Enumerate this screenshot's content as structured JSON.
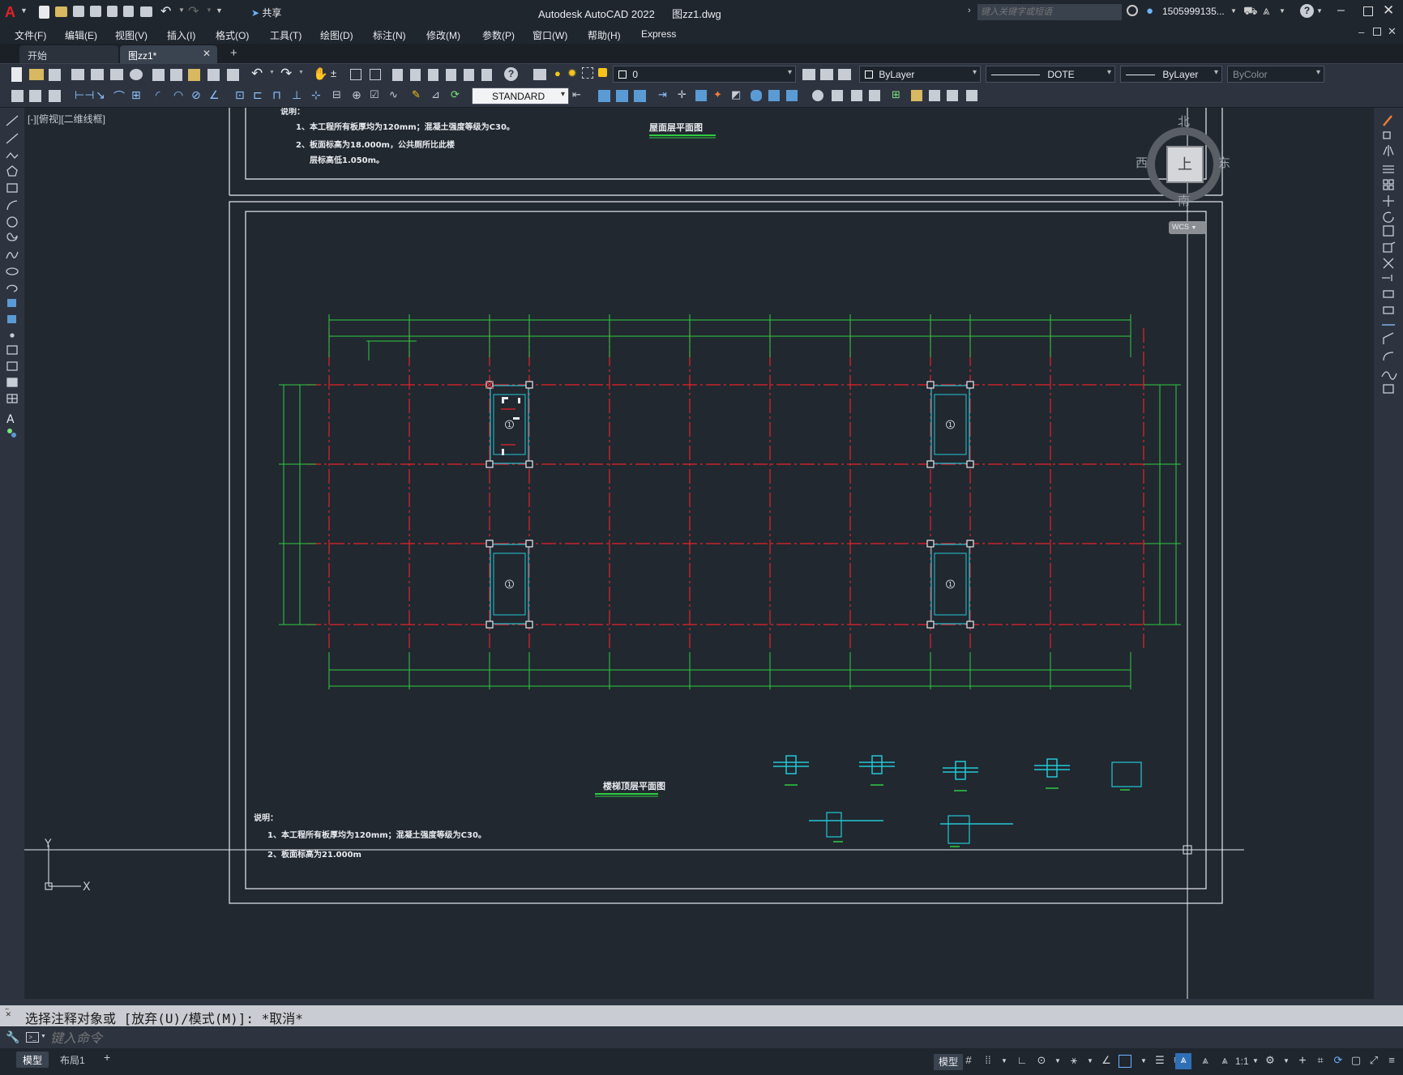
{
  "titlebar": {
    "app_title": "Autodesk AutoCAD 2022",
    "file_name": "图zz1.dwg",
    "share_label": "共享",
    "search_placeholder": "键入关键字或短语",
    "user_name": "1505999135...",
    "help_icon": "help-icon"
  },
  "menus": [
    "文件(F)",
    "编辑(E)",
    "视图(V)",
    "插入(I)",
    "格式(O)",
    "工具(T)",
    "绘图(D)",
    "标注(N)",
    "修改(M)",
    "参数(P)",
    "窗口(W)",
    "帮助(H)",
    "Express"
  ],
  "tabs": {
    "start": "开始",
    "active": "图zz1*",
    "add": "+"
  },
  "layer_combo": "0",
  "color_combo": "ByLayer",
  "linetype_combo": "DOTE",
  "lineweight_combo": "ByLayer",
  "plotstyle_combo": "ByColor",
  "textstyle_combo": "STANDARD",
  "viewport_label": "[-][俯视][二维线框]",
  "viewcube": {
    "north": "北",
    "south": "南",
    "east": "东",
    "west": "西",
    "top": "上",
    "wcs": "WCS"
  },
  "drawing": {
    "top_notes_title": "说明：",
    "top_note_1": "1、本工程所有板厚均为120mm；混凝土强度等级为C30。",
    "top_note_2": "2、板面标高为18.000m，公共厕所比此楼",
    "top_note_3": "层标高低1.050m。",
    "top_plan_title": "屋面层平面图",
    "bottom_plan_title": "楼梯顶层平面图",
    "bottom_notes_title": "说明：",
    "bottom_note_1": "1、本工程所有板厚均为120mm；混凝土强度等级为C30。",
    "bottom_note_2": "2、板面标高为21.000m",
    "slab_mark": "1",
    "ucs_y": "Y",
    "ucs_x": "X"
  },
  "command": {
    "history": "选择注释对象或 [放弃(U)/模式(M)]: *取消*",
    "placeholder": "键入命令"
  },
  "status": {
    "model_tab": "模型",
    "layout_tab": "布局1",
    "add_tab": "+",
    "scale": "1:1"
  }
}
